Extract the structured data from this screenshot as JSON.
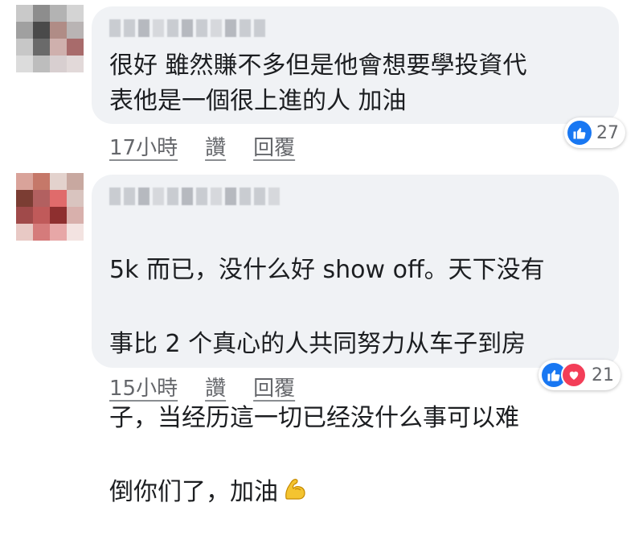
{
  "comments": [
    {
      "avatar_colors": [
        "#c9c9c9",
        "#8d8d8d",
        "#b3b3b3",
        "#d4d4d4",
        "#a0a0a0",
        "#4a4a4a",
        "#b08c86",
        "#b9b4b4",
        "#c7c7c7",
        "#6a6a6a",
        "#cfb0ad",
        "#a86b6b",
        "#dcdcdc",
        "#bdbdbd",
        "#d8cfd0",
        "#e2d9d9"
      ],
      "text": "很好 雖然賺不多但是他會想要學投資代\n表他是一個很上進的人 加油",
      "time": "17小時",
      "like_label": "讚",
      "reply_label": "回覆",
      "reaction_count": "27",
      "reactions": [
        "like-icon"
      ]
    },
    {
      "avatar_colors": [
        "#d9a39a",
        "#c57869",
        "#e3d2cd",
        "#c8a8a0",
        "#7b3d33",
        "#b26060",
        "#e06b6b",
        "#d9c4bf",
        "#a04a4a",
        "#c05a5a",
        "#8e2f2f",
        "#d8b0ac",
        "#e8c9c5",
        "#d57b7b",
        "#e7a7a7",
        "#f3e3e1"
      ],
      "text_lines": [
        "5k 而已，没什么好 show off。天下没有",
        "事比 2 个真心的人共同努力从车子到房",
        "子，当经历這一切已经没什么事可以难",
        "倒你们了，加油"
      ],
      "time": "15小時",
      "like_label": "讚",
      "reply_label": "回覆",
      "reaction_count": "21",
      "reactions": [
        "like-icon",
        "love-icon"
      ],
      "emoji": "flexed-biceps-icon"
    }
  ]
}
